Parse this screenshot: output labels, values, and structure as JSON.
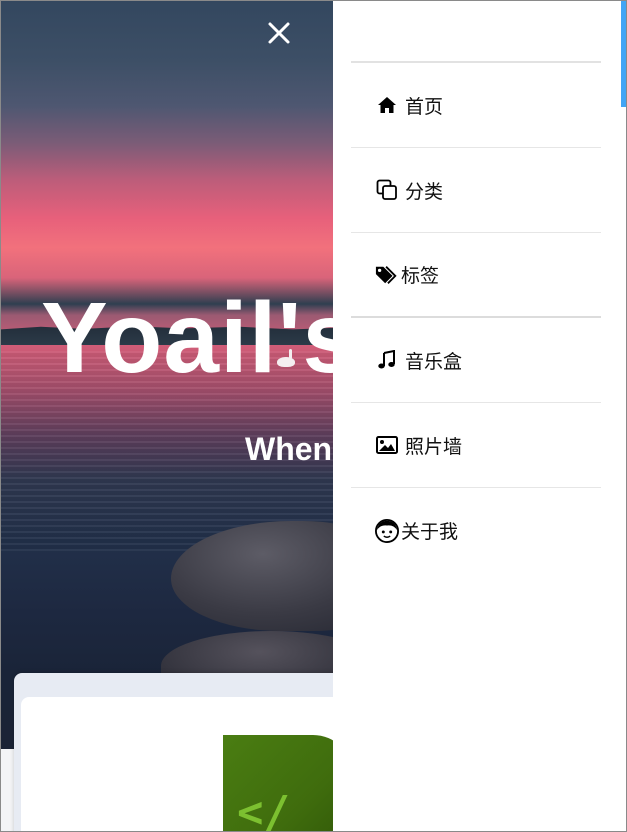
{
  "hero": {
    "title": "Yoail's",
    "subtitle": "When"
  },
  "drawer": {
    "menu": [
      {
        "label": "首页",
        "icon": "home-icon"
      },
      {
        "label": "分类",
        "icon": "copy-icon"
      },
      {
        "label": "标签",
        "icon": "tags-icon"
      },
      {
        "label": "音乐盒",
        "icon": "music-note-icon"
      },
      {
        "label": "照片墙",
        "icon": "image-icon"
      },
      {
        "label": "关于我",
        "icon": "face-icon"
      }
    ]
  },
  "card": {
    "thumbnail_glyph": "</"
  },
  "colors": {
    "scroll_accent": "#42a5f5",
    "card_thumbnail": "#4a7d12"
  }
}
